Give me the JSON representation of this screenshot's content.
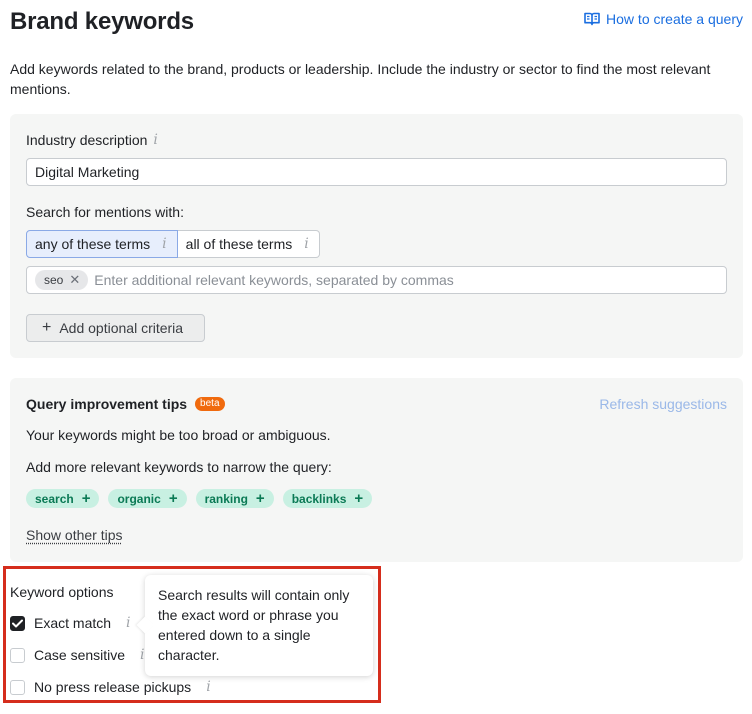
{
  "header": {
    "title": "Brand keywords",
    "help_link": "How to create a query",
    "intro": "Add keywords related to the brand, products or leadership. Include the industry or sector to find the most relevant mentions."
  },
  "query": {
    "industry_label": "Industry description",
    "industry_value": "Digital Marketing",
    "mentions_label": "Search for mentions with:",
    "mode_options": [
      "any of these terms",
      "all of these terms"
    ],
    "mode_selected": "any of these terms",
    "keyword_chips": [
      "seo"
    ],
    "keywords_placeholder": "Enter additional relevant keywords, separated by commas",
    "add_criteria_label": "Add optional criteria"
  },
  "tips": {
    "title": "Query improvement tips",
    "badge": "beta",
    "refresh_label": "Refresh suggestions",
    "message": "Your keywords might be too broad or ambiguous.",
    "suggest_prompt": "Add more relevant keywords to narrow the query:",
    "suggestions": [
      "search",
      "organic",
      "ranking",
      "backlinks"
    ],
    "show_other": "Show other tips"
  },
  "keyword_options": {
    "title": "Keyword options",
    "options": [
      {
        "label": "Exact match",
        "checked": true
      },
      {
        "label": "Case sensitive",
        "checked": false
      },
      {
        "label": "No press release pickups",
        "checked": false
      }
    ],
    "tooltip": "Search results will contain only the exact word or phrase you entered down to a single character."
  },
  "colors": {
    "link": "#1a6ee0",
    "beta_badge": "#f06a0e",
    "suggestion_bg": "#c8f0e2",
    "suggestion_text": "#0b7a55",
    "highlight_box": "#d52d1c"
  },
  "icons": {
    "help_link": "book-icon",
    "info": "info-icon",
    "chip_remove": "close-icon",
    "add": "plus-icon",
    "check": "checkmark-icon"
  }
}
